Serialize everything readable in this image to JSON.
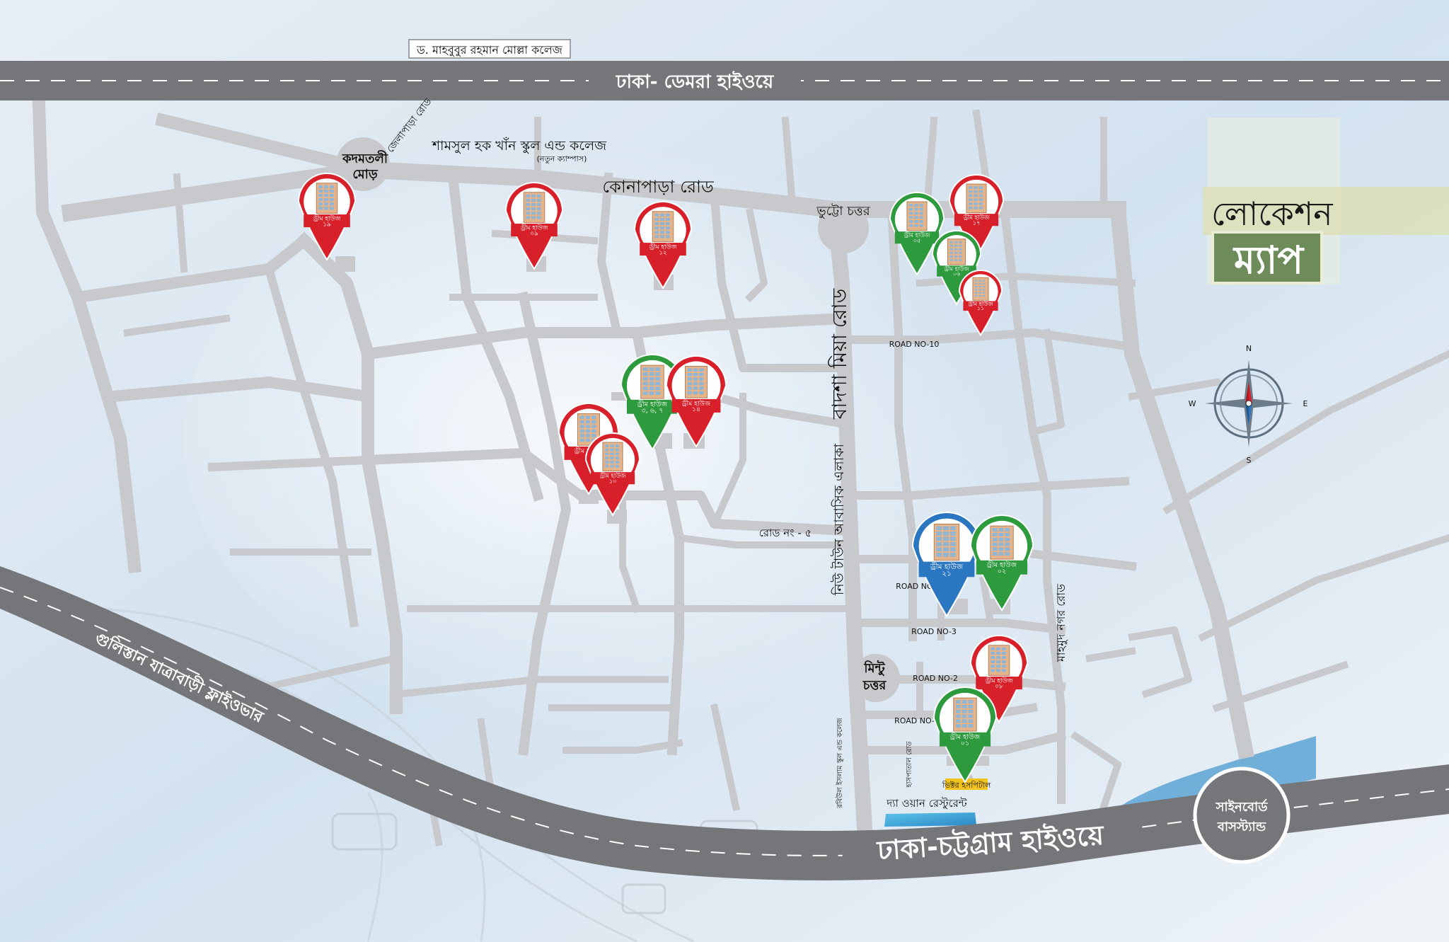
{
  "title": {
    "line1": "লোকেশন",
    "line2": "ম্যাপ"
  },
  "highways": {
    "dhaka_demra": "ঢাকা- ডেমরা হাইওয়ে",
    "dhaka_chittagong": "ঢাকা-চট্টগ্রাম হাইওয়ে",
    "flyover": "গুলিস্তান যাত্রাবাড়ী ফ্লাইওভার"
  },
  "roads": {
    "konapara": "কোনাপাড়া রোড",
    "badsha_mia": "বাদশা মিয়া রোড",
    "road5": "রোড নং - ৫",
    "residential": "নিউ টাউন আবাসিক এলাকা",
    "mahmud_nagar": "মাহমুদ নগর রোড",
    "jela_par": "জেলাপাড়া রোড",
    "road_no_10": "ROAD NO-10",
    "road_no_4": "ROAD NO-4",
    "road_no_3": "ROAD NO-3",
    "road_no_2": "ROAD NO-2",
    "road_no_1": "ROAD NO-1"
  },
  "landmarks": {
    "mahbubur_college": "ড. মাহবুবুর রহমান মোল্লা কলেজ",
    "shamsul_school": "শামসুল হক খাঁন স্কুল এন্ড কলেজ",
    "shamsul_campus": "(নতুন ক্যাম্পাস)",
    "kadamtali_1": "কদমতলী",
    "kadamtali_2": "মোড়",
    "bhutto_chattar": "ভুট্টো চত্তর",
    "mintu_1": "মিন্টু",
    "mintu_2": "চত্তর",
    "rabiul_school": "রবিউল ইসলাম স্কুল এন্ড কলেজ",
    "hospital_small": "হাসপাতাল রোড",
    "hospital_tag": "ভিক্টর হসপিটাল",
    "the_one": "দ্যা ওয়ান রেস্টুরেন্ট",
    "signboard_1": "সাইনবোর্ড",
    "signboard_2": "বাসস্ট্যান্ড"
  },
  "compass": {
    "n": "N",
    "s": "S",
    "e": "E",
    "w": "W"
  },
  "pins": [
    {
      "id": "pin-19",
      "label": "ড্রীম হাউজ",
      "number": "১৯",
      "color": "#d7202a"
    },
    {
      "id": "pin-09",
      "label": "ড্রীম হাউজ",
      "number": "০৯",
      "color": "#d7202a"
    },
    {
      "id": "pin-12",
      "label": "ড্রীম হাউজ",
      "number": "১২",
      "color": "#d7202a"
    },
    {
      "id": "pin-05",
      "label": "ড্রীম হাউজ",
      "number": "০৫",
      "color": "#2e9a3e"
    },
    {
      "id": "pin-17",
      "label": "ড্রীম হাউজ",
      "number": "১৭",
      "color": "#d7202a"
    },
    {
      "id": "pin-06",
      "label": "ড্রীম হাউজ",
      "number": "০৬",
      "color": "#2e9a3e"
    },
    {
      "id": "pin-11",
      "label": "ড্রীম হাউজ",
      "number": "১১",
      "color": "#d7202a"
    },
    {
      "id": "pin-3-6-7",
      "label": "ড্রীম হাউজ",
      "number": "৩, ৬, ৭",
      "color": "#2e9a3e"
    },
    {
      "id": "pin-14",
      "label": "ড্রীম হাউজ",
      "number": "১৪",
      "color": "#d7202a"
    },
    {
      "id": "pin-18",
      "label": "ড্রীম হাউজ",
      "number": "১৮",
      "color": "#d7202a"
    },
    {
      "id": "pin-10",
      "label": "ড্রীম হাউজ",
      "number": "১০",
      "color": "#d7202a"
    },
    {
      "id": "pin-21",
      "label": "ড্রীম হাউজ",
      "number": "২১",
      "color": "#2a76c0"
    },
    {
      "id": "pin-02",
      "label": "ড্রীম হাউজ",
      "number": "০২",
      "color": "#2e9a3e"
    },
    {
      "id": "pin-08",
      "label": "ড্রীম হাউজ",
      "number": "০৮",
      "color": "#d7202a"
    },
    {
      "id": "pin-01",
      "label": "ড্রীম হাউজ",
      "number": "০১",
      "color": "#2e9a3e"
    }
  ]
}
